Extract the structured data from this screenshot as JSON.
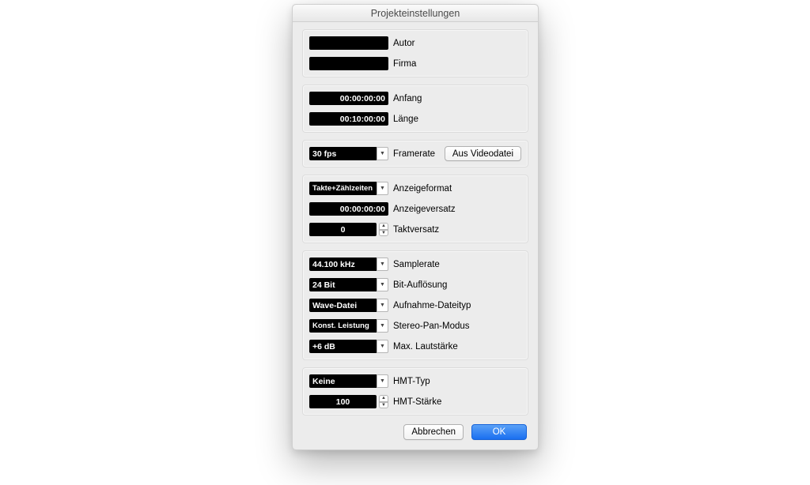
{
  "title": "Projekteinstellungen",
  "meta": {
    "author_value": "",
    "author_label": "Autor",
    "company_value": "",
    "company_label": "Firma"
  },
  "time": {
    "start_value": "00:00:00:00",
    "start_label": "Anfang",
    "length_value": "00:10:00:00",
    "length_label": "Länge"
  },
  "frame": {
    "rate_value": "30 fps",
    "rate_label": "Framerate",
    "from_video_label": "Aus Videodatei"
  },
  "display": {
    "format_value": "Takte+Zählzeiten",
    "format_label": "Anzeigeformat",
    "offset_time_value": "00:00:00:00",
    "offset_time_label": "Anzeigeversatz",
    "bar_offset_value": "0",
    "bar_offset_label": "Taktversatz"
  },
  "audio": {
    "sr_value": "44.100 kHz",
    "sr_label": "Samplerate",
    "bit_value": "24 Bit",
    "bit_label": "Bit-Auflösung",
    "rec_value": "Wave-Datei",
    "rec_label": "Aufnahme-Dateityp",
    "pan_value": "Konst. Leistung",
    "pan_label": "Stereo-Pan-Modus",
    "max_value": "+6 dB",
    "max_label": "Max. Lautstärke"
  },
  "hmt": {
    "type_value": "Keine",
    "type_label": "HMT-Typ",
    "depth_value": "100",
    "depth_label": "HMT-Stärke"
  },
  "buttons": {
    "cancel": "Abbrechen",
    "ok": "OK"
  }
}
